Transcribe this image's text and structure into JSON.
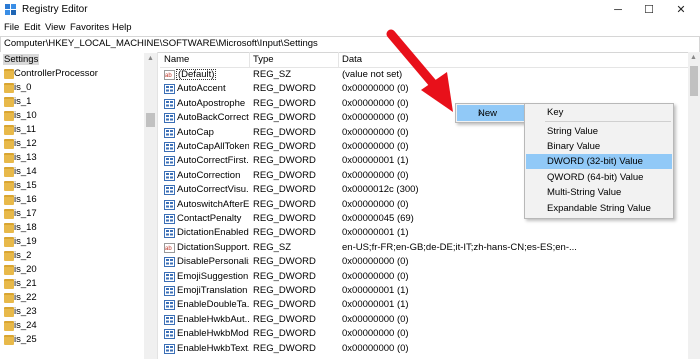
{
  "window": {
    "title": "Registry Editor",
    "controls": {
      "minimize": "─",
      "maximize": "☐",
      "close": "✕"
    }
  },
  "menu": [
    "File",
    "Edit",
    "View",
    "Favorites",
    "Help"
  ],
  "address": "Computer\\HKEY_LOCAL_MACHINE\\SOFTWARE\\Microsoft\\Input\\Settings",
  "tree": {
    "items": [
      "Settings",
      "ControllerProcessor",
      "is_0",
      "is_1",
      "is_10",
      "is_11",
      "is_12",
      "is_13",
      "is_14",
      "is_15",
      "is_16",
      "is_17",
      "is_18",
      "is_19",
      "is_2",
      "is_20",
      "is_21",
      "is_22",
      "is_23",
      "is_24",
      "is_25"
    ]
  },
  "list": {
    "columns": {
      "name": "Name",
      "type": "Type",
      "data": "Data"
    },
    "rows": [
      {
        "name": "(Default)",
        "type": "REG_SZ",
        "data": "(value not set)",
        "icon": "string-value-icon"
      },
      {
        "name": "AutoAccent",
        "type": "REG_DWORD",
        "data": "0x00000000 (0)",
        "icon": "dword-value-icon"
      },
      {
        "name": "AutoApostrophe",
        "type": "REG_DWORD",
        "data": "0x00000000 (0)",
        "icon": "dword-value-icon"
      },
      {
        "name": "AutoBackCorrecti...",
        "type": "REG_DWORD",
        "data": "0x00000000 (0)",
        "icon": "dword-value-icon"
      },
      {
        "name": "AutoCap",
        "type": "REG_DWORD",
        "data": "0x00000000 (0)",
        "icon": "dword-value-icon"
      },
      {
        "name": "AutoCapAllTokens",
        "type": "REG_DWORD",
        "data": "0x00000000 (0)",
        "icon": "dword-value-icon"
      },
      {
        "name": "AutoCorrectFirst...",
        "type": "REG_DWORD",
        "data": "0x00000001 (1)",
        "icon": "dword-value-icon"
      },
      {
        "name": "AutoCorrection",
        "type": "REG_DWORD",
        "data": "0x00000000 (0)",
        "icon": "dword-value-icon"
      },
      {
        "name": "AutoCorrectVisu...",
        "type": "REG_DWORD",
        "data": "0x0000012c (300)",
        "icon": "dword-value-icon"
      },
      {
        "name": "AutoswitchAfterE...",
        "type": "REG_DWORD",
        "data": "0x00000000 (0)",
        "icon": "dword-value-icon"
      },
      {
        "name": "ContactPenalty",
        "type": "REG_DWORD",
        "data": "0x00000045 (69)",
        "icon": "dword-value-icon"
      },
      {
        "name": "DictationEnabled",
        "type": "REG_DWORD",
        "data": "0x00000001 (1)",
        "icon": "dword-value-icon"
      },
      {
        "name": "DictationSupport...",
        "type": "REG_SZ",
        "data": "en-US;fr-FR;en-GB;de-DE;it-IT;zh-hans-CN;es-ES;en-...",
        "icon": "string-value-icon"
      },
      {
        "name": "DisablePersonaliz...",
        "type": "REG_DWORD",
        "data": "0x00000000 (0)",
        "icon": "dword-value-icon"
      },
      {
        "name": "EmojiSuggestion",
        "type": "REG_DWORD",
        "data": "0x00000000 (0)",
        "icon": "dword-value-icon"
      },
      {
        "name": "EmojiTranslation",
        "type": "REG_DWORD",
        "data": "0x00000001 (1)",
        "icon": "dword-value-icon"
      },
      {
        "name": "EnableDoubleTa...",
        "type": "REG_DWORD",
        "data": "0x00000001 (1)",
        "icon": "dword-value-icon"
      },
      {
        "name": "EnableHwkbAut...",
        "type": "REG_DWORD",
        "data": "0x00000000 (0)",
        "icon": "dword-value-icon"
      },
      {
        "name": "EnableHwkbMode",
        "type": "REG_DWORD",
        "data": "0x00000000 (0)",
        "icon": "dword-value-icon"
      },
      {
        "name": "EnableHwkbText...",
        "type": "REG_DWORD",
        "data": "0x00000000 (0)",
        "icon": "dword-value-icon"
      }
    ]
  },
  "context_menu": {
    "new_label": "New",
    "submenu": [
      "Key",
      "String Value",
      "Binary Value",
      "DWORD (32-bit) Value",
      "QWORD (64-bit) Value",
      "Multi-String Value",
      "Expandable String Value"
    ],
    "highlighted": "DWORD (32-bit) Value"
  },
  "colors": {
    "highlight": "#91c9f7",
    "annotation_arrow": "#e8101a"
  }
}
